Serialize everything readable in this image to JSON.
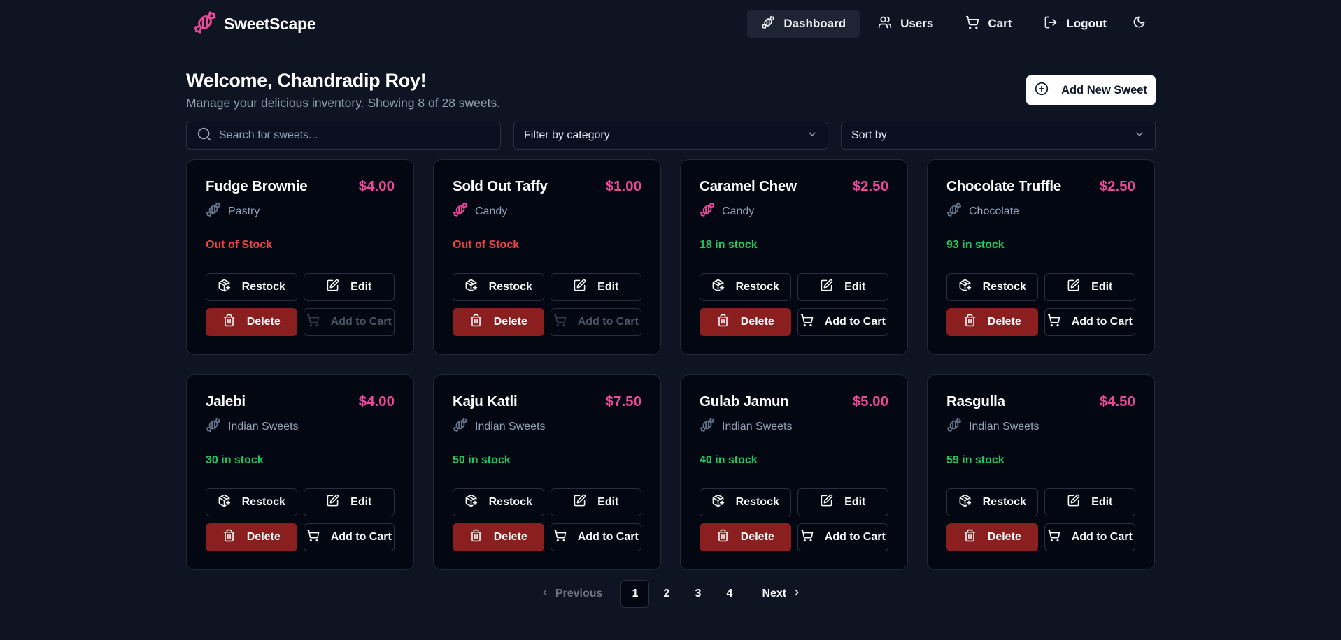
{
  "brand": {
    "name": "SweetScape",
    "accent": "#ec4899"
  },
  "nav": {
    "items": [
      {
        "label": "Dashboard",
        "icon": "candy-icon",
        "active": true
      },
      {
        "label": "Users",
        "icon": "users-icon"
      },
      {
        "label": "Cart",
        "icon": "cart-icon"
      },
      {
        "label": "Logout",
        "icon": "logout-icon"
      }
    ],
    "theme_icon": "moon-icon"
  },
  "welcome": {
    "title": "Welcome, Chandradip Roy!",
    "subtitle": "Manage your delicious inventory. Showing 8 of 28 sweets.",
    "add_button": "Add New Sweet"
  },
  "filters": {
    "search_placeholder": "Search for sweets...",
    "category": "Filter by category",
    "sort": "Sort by"
  },
  "buttons": {
    "restock": "Restock",
    "edit": "Edit",
    "delete": "Delete",
    "add_to_cart": "Add to Cart"
  },
  "products": [
    {
      "name": "Fudge Brownie",
      "price": "$4.00",
      "category": "Pastry",
      "stock": "Out of Stock",
      "in_stock": false
    },
    {
      "name": "Sold Out Taffy",
      "price": "$1.00",
      "category": "Candy",
      "stock": "Out of Stock",
      "in_stock": false
    },
    {
      "name": "Caramel Chew",
      "price": "$2.50",
      "category": "Candy",
      "stock": "18 in stock",
      "in_stock": true
    },
    {
      "name": "Chocolate Truffle",
      "price": "$2.50",
      "category": "Chocolate",
      "stock": "93 in stock",
      "in_stock": true
    },
    {
      "name": "Jalebi",
      "price": "$4.00",
      "category": "Indian Sweets",
      "stock": "30 in stock",
      "in_stock": true
    },
    {
      "name": "Kaju Katli",
      "price": "$7.50",
      "category": "Indian Sweets",
      "stock": "50 in stock",
      "in_stock": true
    },
    {
      "name": "Gulab Jamun",
      "price": "$5.00",
      "category": "Indian Sweets",
      "stock": "40 in stock",
      "in_stock": true
    },
    {
      "name": "Rasgulla",
      "price": "$4.50",
      "category": "Indian Sweets",
      "stock": "59 in stock",
      "in_stock": true
    }
  ],
  "pagination": {
    "previous": "Previous",
    "next": "Next",
    "pages": [
      "1",
      "2",
      "3",
      "4"
    ],
    "current": "1"
  }
}
